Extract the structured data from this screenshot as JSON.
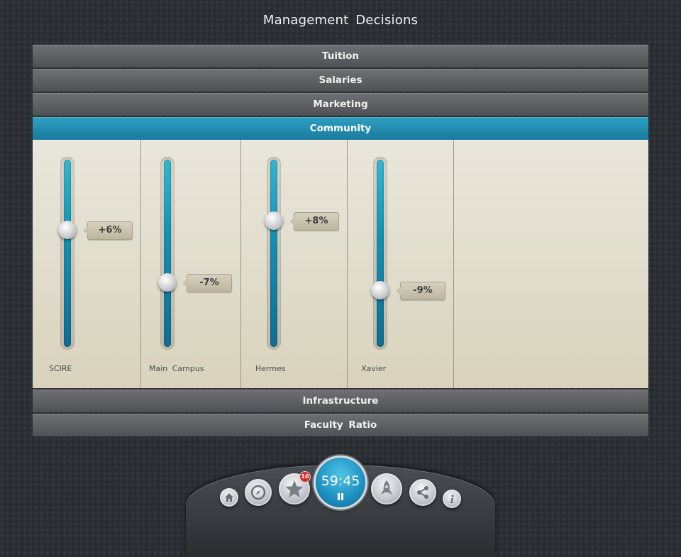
{
  "page": {
    "title": "Management Decisions"
  },
  "sections": {
    "tuition": "Tuition",
    "salaries": "Salaries",
    "marketing": "Marketing",
    "community": "Community",
    "infrastructure": "Infrastructure",
    "faculty_ratio": "Faculty Ratio"
  },
  "community": {
    "sliders": [
      {
        "label": "SCIRE",
        "value": "+6%",
        "level": 0.62
      },
      {
        "label": "Main Campus",
        "value": "-7%",
        "level": 0.35
      },
      {
        "label": "Hermes",
        "value": "+8%",
        "level": 0.67
      },
      {
        "label": "Xavier",
        "value": "-9%",
        "level": 0.31
      }
    ]
  },
  "dock": {
    "timer": "59:45",
    "badge_count": "10",
    "icons": [
      "home-icon",
      "compass-icon",
      "star-icon",
      "rocket-icon",
      "share-icon",
      "info-icon"
    ]
  },
  "colors": {
    "accent": "#1c8fc0",
    "active_header": "#2590b4",
    "badge": "#c9302c"
  }
}
